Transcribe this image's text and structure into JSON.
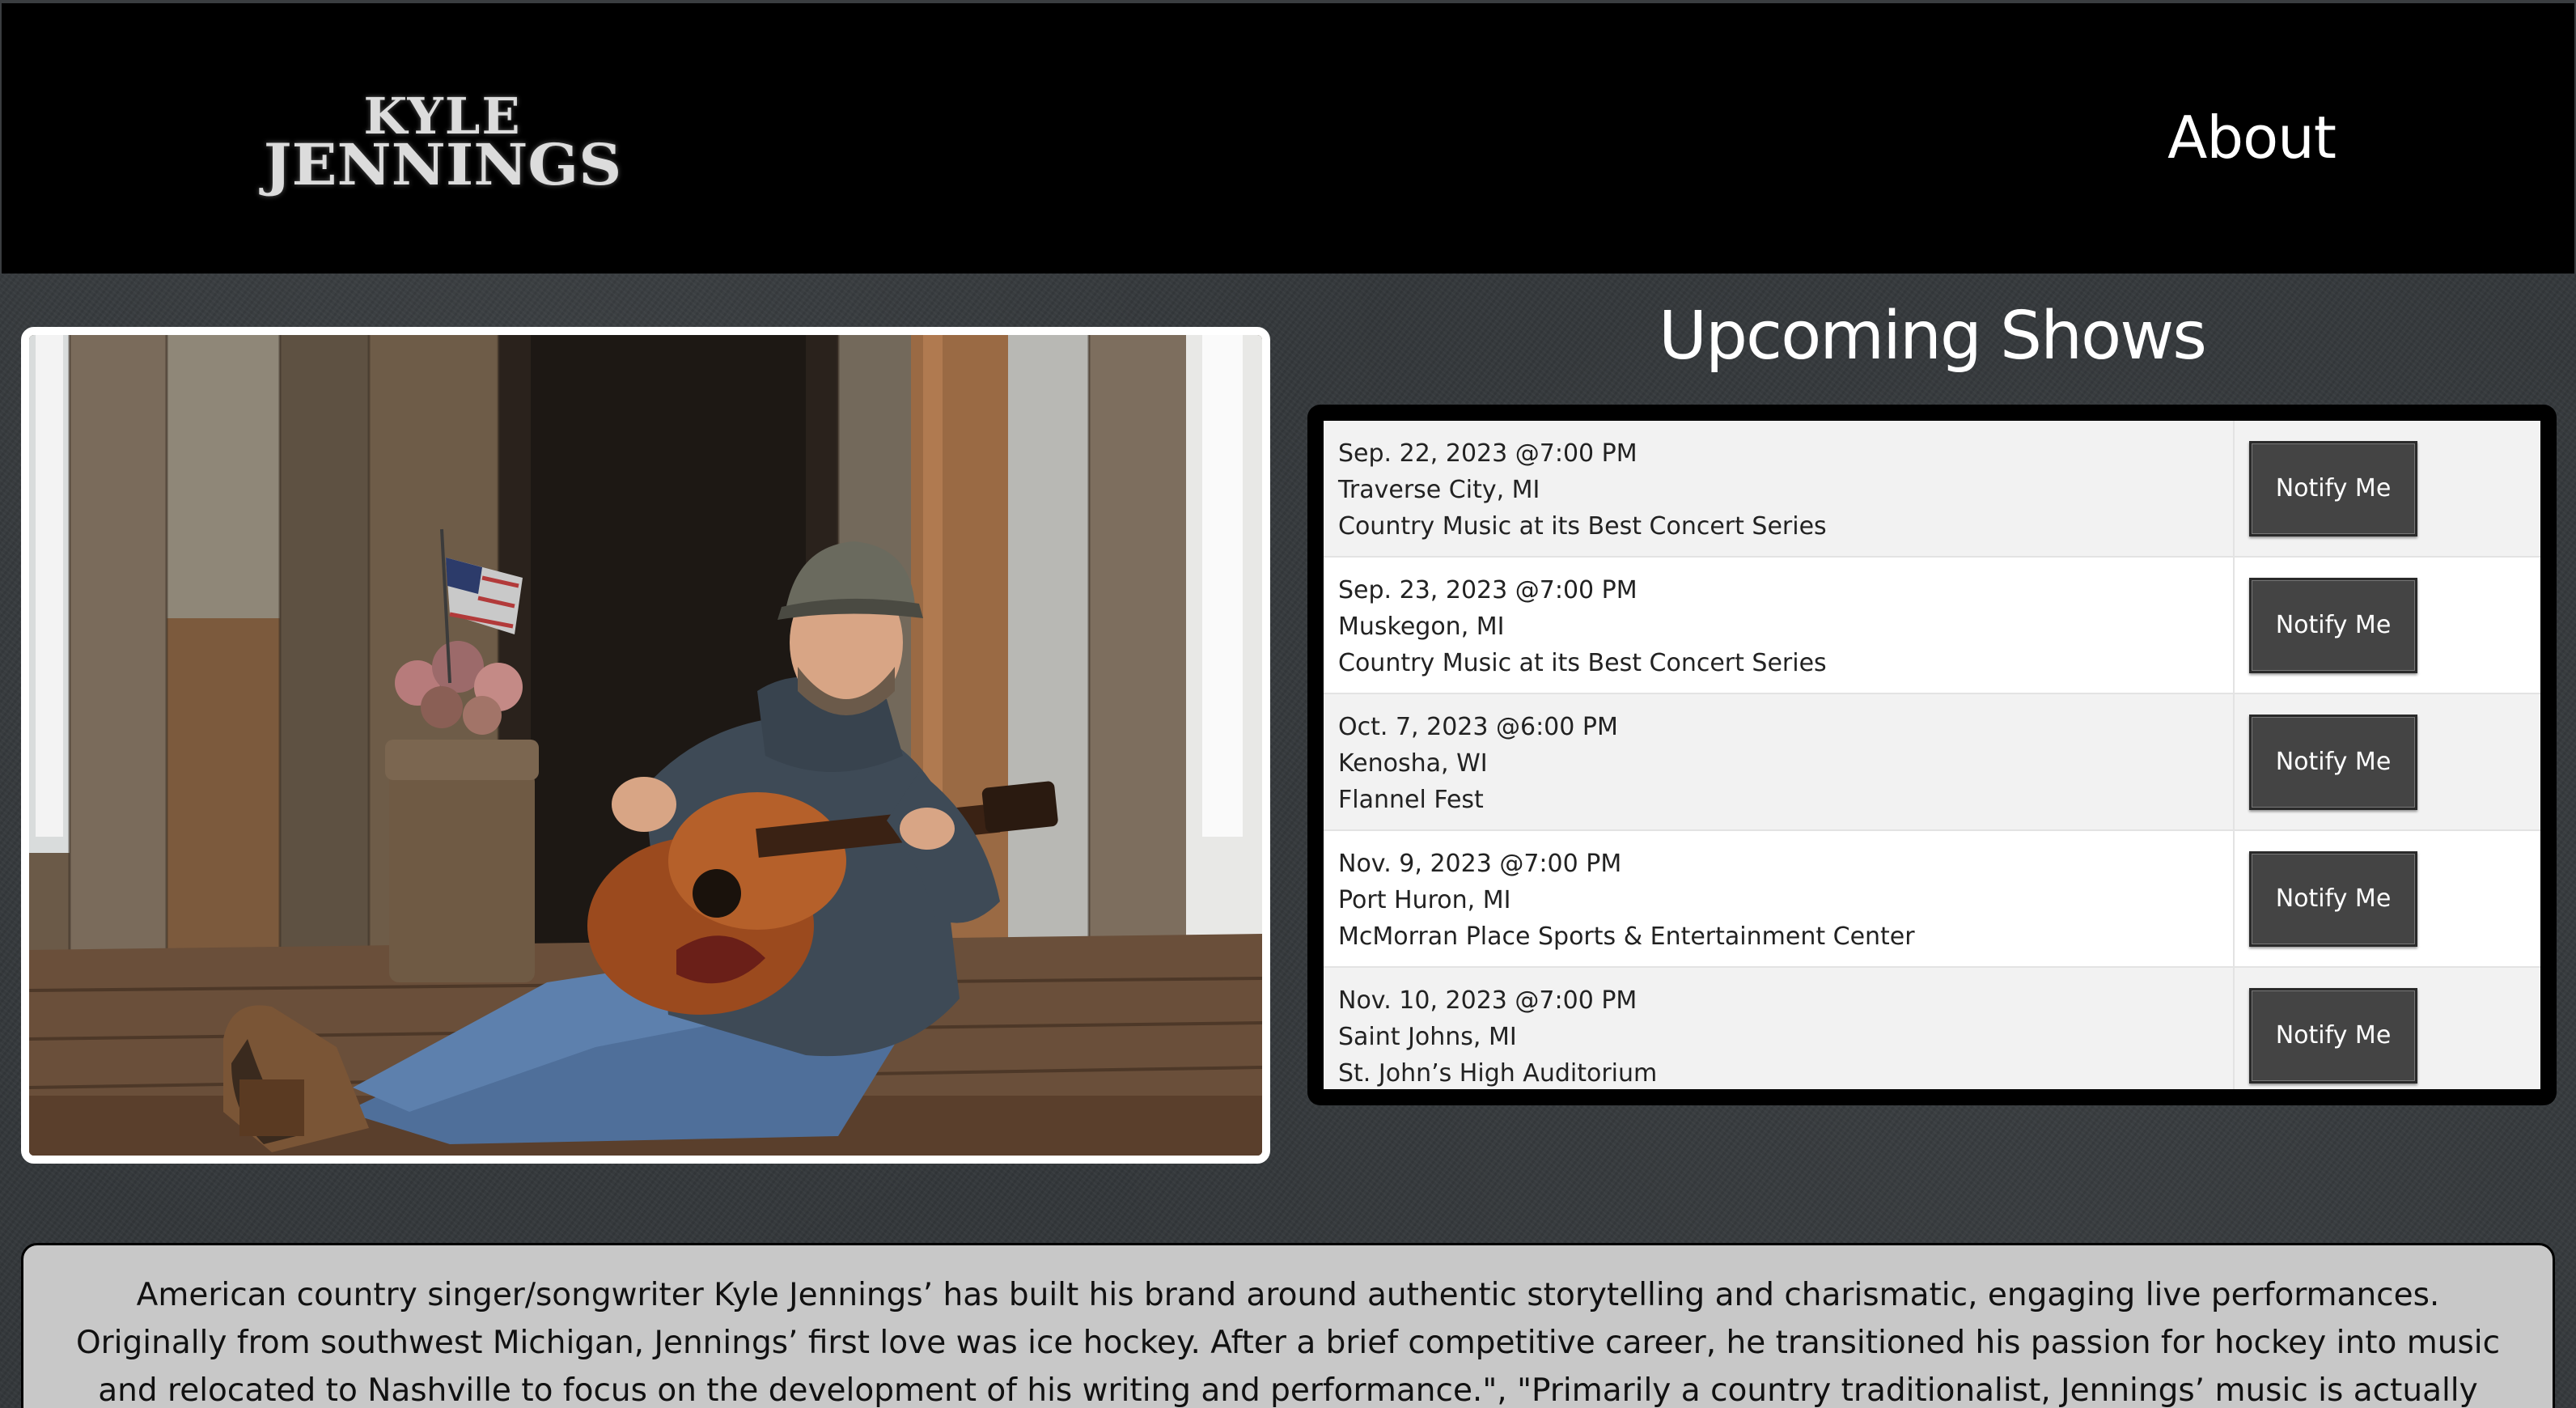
{
  "header": {
    "logo_line1": "KYLE",
    "logo_line2": "JENNINGS",
    "nav_about": "About"
  },
  "hero": {
    "photo_icon": "artist-with-guitar-photo"
  },
  "shows": {
    "title": "Upcoming Shows",
    "button_label": "Notify Me",
    "items": [
      {
        "date": "Sep. 22, 2023 @7:00 PM",
        "city": "Traverse City, MI",
        "venue": "Country Music at its Best Concert Series"
      },
      {
        "date": "Sep. 23, 2023 @7:00 PM",
        "city": "Muskegon, MI",
        "venue": "Country Music at its Best Concert Series"
      },
      {
        "date": "Oct. 7, 2023 @6:00 PM",
        "city": "Kenosha, WI",
        "venue": "Flannel Fest"
      },
      {
        "date": "Nov. 9, 2023 @7:00 PM",
        "city": "Port Huron, MI",
        "venue": "McMorran Place Sports & Entertainment Center"
      },
      {
        "date": "Nov. 10, 2023 @7:00 PM",
        "city": "Saint Johns, MI",
        "venue": "St. John’s High Auditorium"
      }
    ]
  },
  "bio": {
    "text": "American country singer/songwriter Kyle Jennings’ has built his brand around authentic storytelling and charismatic, engaging live performances. Originally from southwest Michigan, Jennings’ first love was ice hockey. After a brief competitive career, he transitioned his passion for hockey into music and relocated to Nashville to focus on the development of his writing and performance.\", \"Primarily a country traditionalist, Jennings’ music is actually quite diverse. A rootsy foundation of"
  }
}
